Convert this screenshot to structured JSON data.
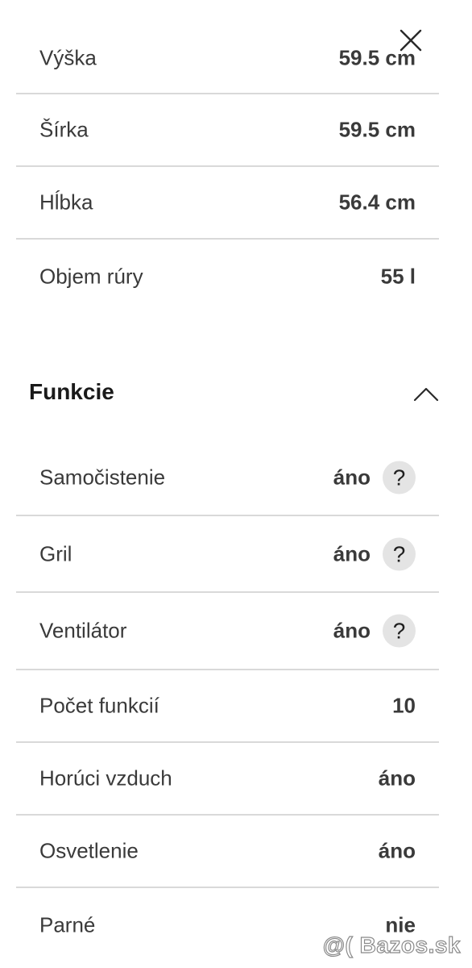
{
  "dimensions_rows": [
    {
      "label": "Výška",
      "value": "59.5 cm"
    },
    {
      "label": "Šírka",
      "value": "59.5 cm"
    },
    {
      "label": "Hĺbka",
      "value": "56.4 cm"
    },
    {
      "label": "Objem rúry",
      "value": "55 l"
    }
  ],
  "functions": {
    "title": "Funkcie",
    "rows": [
      {
        "label": "Samočistenie",
        "value": "áno",
        "help": "?"
      },
      {
        "label": "Gril",
        "value": "áno",
        "help": "?"
      },
      {
        "label": "Ventilátor",
        "value": "áno",
        "help": "?"
      },
      {
        "label": "Počet funkcií",
        "value": "10"
      },
      {
        "label": "Horúci vzduch",
        "value": "áno"
      },
      {
        "label": "Osvetlenie",
        "value": "áno"
      },
      {
        "label": "Parné",
        "value": "nie"
      }
    ]
  },
  "watermark": "@( Bazos.sk",
  "icons": {
    "close": "close-icon",
    "collapse": "chevron-up-icon",
    "help": "question-icon"
  }
}
